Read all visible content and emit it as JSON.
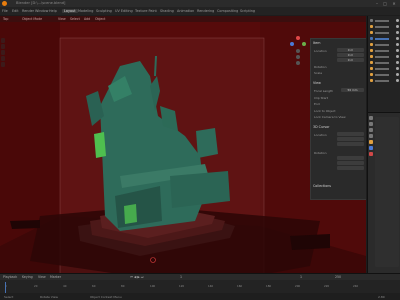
{
  "app": {
    "title": "Blender [D:\\...\\scene.blend]",
    "window_controls": [
      "–",
      "□",
      "✕"
    ]
  },
  "menubar": {
    "file_menu": [
      "File",
      "Edit",
      "Render",
      "Window",
      "Help"
    ],
    "workspace_tabs": [
      "Layout",
      "Modeling",
      "Sculpting",
      "UV Editing",
      "Texture Paint",
      "Shading",
      "Animation",
      "Rendering",
      "Compositing",
      "Scripting"
    ],
    "active_tab": "Layout"
  },
  "viewport": {
    "mode": "Object Mode",
    "view_menu": [
      "View",
      "Select",
      "Add",
      "Object"
    ],
    "label": "Top"
  },
  "properties_panel": {
    "sections": [
      "Item",
      "View",
      "3D Cursor",
      "Collections"
    ],
    "item": {
      "location_label": "Location",
      "location": [
        "0 m",
        "0 m",
        "0 m"
      ],
      "rotation_label": "Rotation",
      "scale_label": "Scale"
    },
    "view": {
      "focal_label": "Focal Length",
      "focal_value": "50 mm",
      "clip_label": "Clip Start",
      "clip_end_label": "End",
      "lock_label": "Lock to Object",
      "camera_lock_label": "Lock Camera to View"
    },
    "cursor": {
      "location_label": "Location",
      "rotation_label": "Rotation"
    }
  },
  "timeline": {
    "controls": [
      "Playback",
      "Keying",
      "View",
      "Marker"
    ],
    "frame_numbers": [
      "0",
      "20",
      "40",
      "60",
      "80",
      "100",
      "120",
      "140",
      "160",
      "180",
      "200",
      "220",
      "240"
    ],
    "current_frame": "1",
    "start": "1",
    "end": "250"
  },
  "statusbar": {
    "left": "Select",
    "middle": "Rotate View",
    "right": "Object Context Menu",
    "version": "2.80"
  },
  "colors": {
    "viewport_bg": "#5a0c0c",
    "model": "#2e6b5a",
    "accent": "#4772b3"
  }
}
